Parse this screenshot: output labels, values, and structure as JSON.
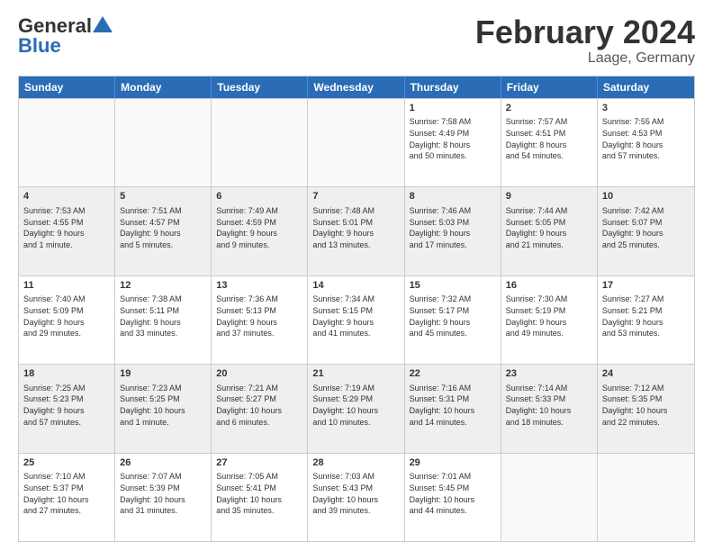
{
  "header": {
    "logo_line1": "General",
    "logo_line2": "Blue",
    "title": "February 2024",
    "subtitle": "Laage, Germany"
  },
  "weekdays": [
    "Sunday",
    "Monday",
    "Tuesday",
    "Wednesday",
    "Thursday",
    "Friday",
    "Saturday"
  ],
  "rows": [
    [
      {
        "day": "",
        "info": "",
        "empty": true
      },
      {
        "day": "",
        "info": "",
        "empty": true
      },
      {
        "day": "",
        "info": "",
        "empty": true
      },
      {
        "day": "",
        "info": "",
        "empty": true
      },
      {
        "day": "1",
        "info": "Sunrise: 7:58 AM\nSunset: 4:49 PM\nDaylight: 8 hours\nand 50 minutes."
      },
      {
        "day": "2",
        "info": "Sunrise: 7:57 AM\nSunset: 4:51 PM\nDaylight: 8 hours\nand 54 minutes."
      },
      {
        "day": "3",
        "info": "Sunrise: 7:55 AM\nSunset: 4:53 PM\nDaylight: 8 hours\nand 57 minutes."
      }
    ],
    [
      {
        "day": "4",
        "info": "Sunrise: 7:53 AM\nSunset: 4:55 PM\nDaylight: 9 hours\nand 1 minute.",
        "shaded": true
      },
      {
        "day": "5",
        "info": "Sunrise: 7:51 AM\nSunset: 4:57 PM\nDaylight: 9 hours\nand 5 minutes.",
        "shaded": true
      },
      {
        "day": "6",
        "info": "Sunrise: 7:49 AM\nSunset: 4:59 PM\nDaylight: 9 hours\nand 9 minutes.",
        "shaded": true
      },
      {
        "day": "7",
        "info": "Sunrise: 7:48 AM\nSunset: 5:01 PM\nDaylight: 9 hours\nand 13 minutes.",
        "shaded": true
      },
      {
        "day": "8",
        "info": "Sunrise: 7:46 AM\nSunset: 5:03 PM\nDaylight: 9 hours\nand 17 minutes.",
        "shaded": true
      },
      {
        "day": "9",
        "info": "Sunrise: 7:44 AM\nSunset: 5:05 PM\nDaylight: 9 hours\nand 21 minutes.",
        "shaded": true
      },
      {
        "day": "10",
        "info": "Sunrise: 7:42 AM\nSunset: 5:07 PM\nDaylight: 9 hours\nand 25 minutes.",
        "shaded": true
      }
    ],
    [
      {
        "day": "11",
        "info": "Sunrise: 7:40 AM\nSunset: 5:09 PM\nDaylight: 9 hours\nand 29 minutes."
      },
      {
        "day": "12",
        "info": "Sunrise: 7:38 AM\nSunset: 5:11 PM\nDaylight: 9 hours\nand 33 minutes."
      },
      {
        "day": "13",
        "info": "Sunrise: 7:36 AM\nSunset: 5:13 PM\nDaylight: 9 hours\nand 37 minutes."
      },
      {
        "day": "14",
        "info": "Sunrise: 7:34 AM\nSunset: 5:15 PM\nDaylight: 9 hours\nand 41 minutes."
      },
      {
        "day": "15",
        "info": "Sunrise: 7:32 AM\nSunset: 5:17 PM\nDaylight: 9 hours\nand 45 minutes."
      },
      {
        "day": "16",
        "info": "Sunrise: 7:30 AM\nSunset: 5:19 PM\nDaylight: 9 hours\nand 49 minutes."
      },
      {
        "day": "17",
        "info": "Sunrise: 7:27 AM\nSunset: 5:21 PM\nDaylight: 9 hours\nand 53 minutes."
      }
    ],
    [
      {
        "day": "18",
        "info": "Sunrise: 7:25 AM\nSunset: 5:23 PM\nDaylight: 9 hours\nand 57 minutes.",
        "shaded": true
      },
      {
        "day": "19",
        "info": "Sunrise: 7:23 AM\nSunset: 5:25 PM\nDaylight: 10 hours\nand 1 minute.",
        "shaded": true
      },
      {
        "day": "20",
        "info": "Sunrise: 7:21 AM\nSunset: 5:27 PM\nDaylight: 10 hours\nand 6 minutes.",
        "shaded": true
      },
      {
        "day": "21",
        "info": "Sunrise: 7:19 AM\nSunset: 5:29 PM\nDaylight: 10 hours\nand 10 minutes.",
        "shaded": true
      },
      {
        "day": "22",
        "info": "Sunrise: 7:16 AM\nSunset: 5:31 PM\nDaylight: 10 hours\nand 14 minutes.",
        "shaded": true
      },
      {
        "day": "23",
        "info": "Sunrise: 7:14 AM\nSunset: 5:33 PM\nDaylight: 10 hours\nand 18 minutes.",
        "shaded": true
      },
      {
        "day": "24",
        "info": "Sunrise: 7:12 AM\nSunset: 5:35 PM\nDaylight: 10 hours\nand 22 minutes.",
        "shaded": true
      }
    ],
    [
      {
        "day": "25",
        "info": "Sunrise: 7:10 AM\nSunset: 5:37 PM\nDaylight: 10 hours\nand 27 minutes."
      },
      {
        "day": "26",
        "info": "Sunrise: 7:07 AM\nSunset: 5:39 PM\nDaylight: 10 hours\nand 31 minutes."
      },
      {
        "day": "27",
        "info": "Sunrise: 7:05 AM\nSunset: 5:41 PM\nDaylight: 10 hours\nand 35 minutes."
      },
      {
        "day": "28",
        "info": "Sunrise: 7:03 AM\nSunset: 5:43 PM\nDaylight: 10 hours\nand 39 minutes."
      },
      {
        "day": "29",
        "info": "Sunrise: 7:01 AM\nSunset: 5:45 PM\nDaylight: 10 hours\nand 44 minutes."
      },
      {
        "day": "",
        "info": "",
        "empty": true
      },
      {
        "day": "",
        "info": "",
        "empty": true
      }
    ]
  ]
}
